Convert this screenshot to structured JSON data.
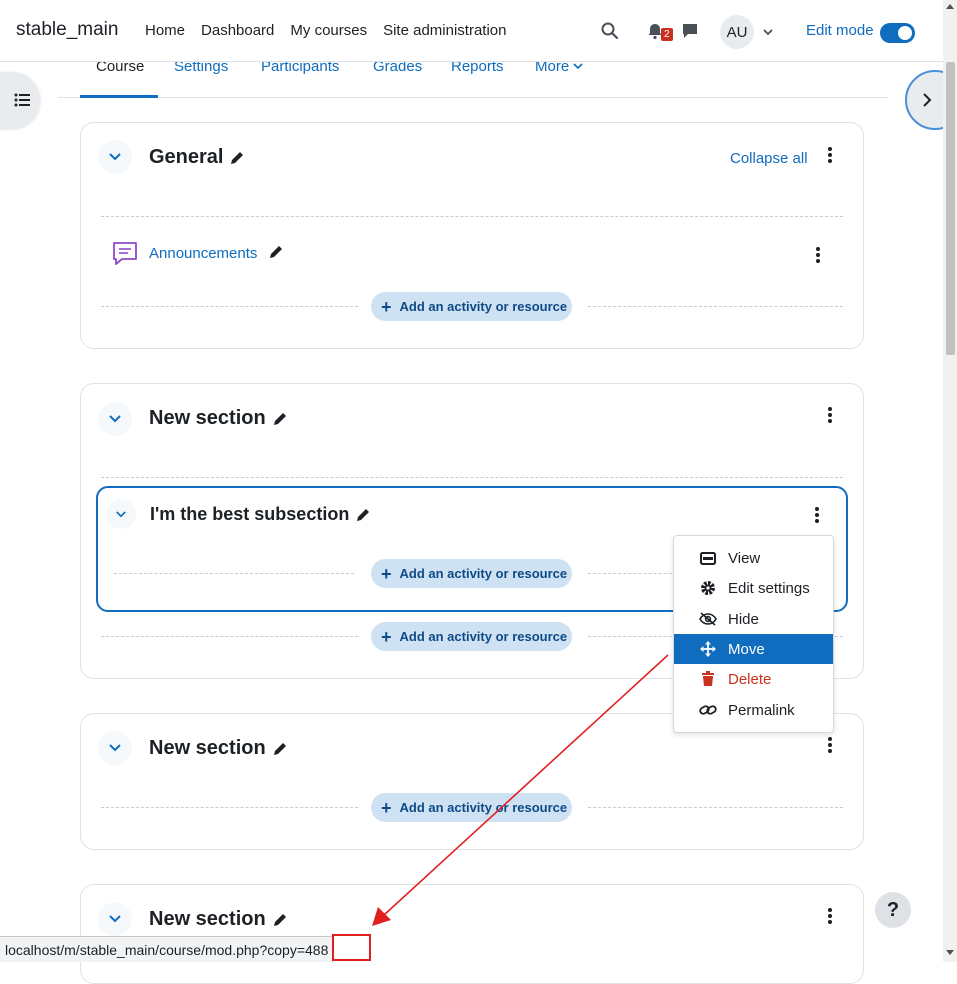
{
  "navbar": {
    "brand": "stable_main",
    "links": [
      "Home",
      "Dashboard",
      "My courses",
      "Site administration"
    ],
    "notification_count": "2",
    "avatar_initials": "AU",
    "edit_mode_label": "Edit mode",
    "edit_mode_on": true,
    "icons": [
      "search-icon",
      "bell-icon",
      "chat-icon",
      "chevron-down-icon"
    ]
  },
  "secondary_nav": {
    "tabs": [
      "Course",
      "Settings",
      "Participants",
      "Grades",
      "Reports",
      "More"
    ],
    "active_tab": "Course"
  },
  "sections": [
    {
      "title": "General",
      "collapse_all_label": "Collapse all",
      "activities": [
        {
          "name": "Announcements",
          "icon": "forum-icon"
        }
      ],
      "add_label": "Add an activity or resource"
    },
    {
      "title": "New section",
      "subsection": {
        "title": "I'm the best subsection",
        "add_label": "Add an activity or resource"
      },
      "add_label": "Add an activity or resource"
    },
    {
      "title": "New section",
      "add_label": "Add an activity or resource"
    },
    {
      "title": "New section"
    }
  ],
  "context_menu": {
    "items": [
      {
        "label": "View",
        "icon": "view-icon"
      },
      {
        "label": "Edit settings",
        "icon": "gear-icon"
      },
      {
        "label": "Hide",
        "icon": "eye-slash-icon"
      },
      {
        "label": "Move",
        "icon": "move-icon"
      },
      {
        "label": "Delete",
        "icon": "trash-icon"
      },
      {
        "label": "Permalink",
        "icon": "link-icon"
      }
    ],
    "highlighted": "Move"
  },
  "status_bar": {
    "url": "localhost/m/stable_main/course/mod.php?copy=488"
  },
  "help_button_label": "?",
  "colors": {
    "accent": "#0f6cbf",
    "danger": "#ca3120",
    "annotation": "#e02020",
    "add_button_bg": "#cfe2f3"
  }
}
